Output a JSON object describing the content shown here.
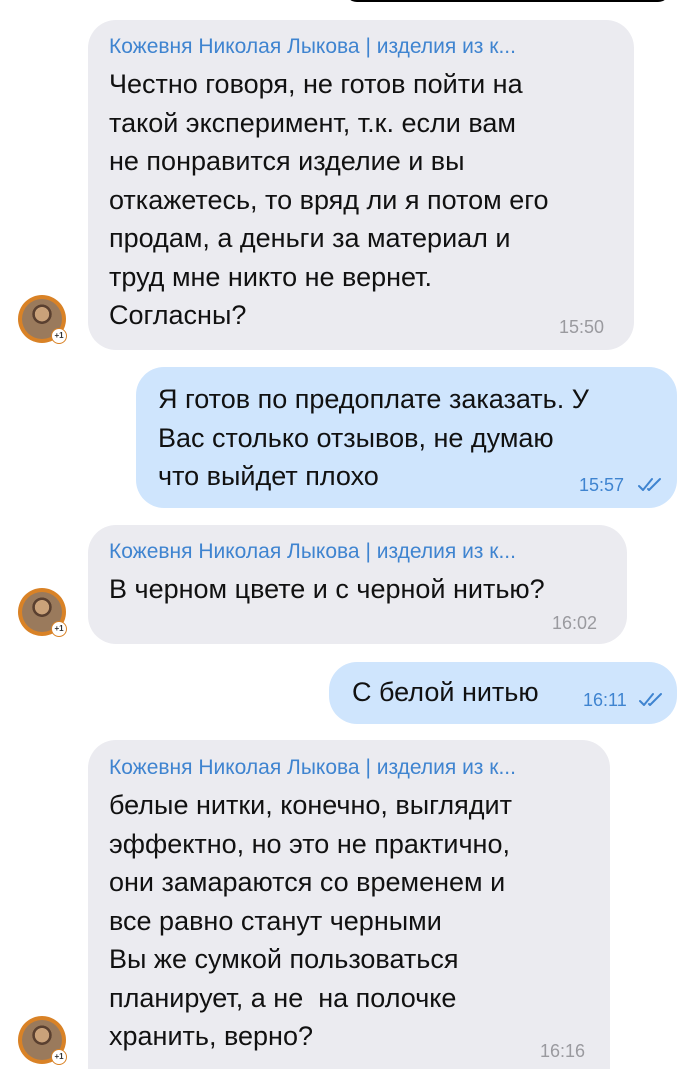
{
  "messages": [
    {
      "sender": "Кожевня Николая Лыкова | изделия из к...",
      "text": "Честно говоря, не готов пойти на\nтакой эксперимент, т.к. если вам\nне понравится изделие и вы\nоткажетесь, то вряд ли я потом его\nпродам, а деньги за материал и\nтруд мне никто не вернет.\nСогласны?",
      "time": "15:50"
    },
    {
      "text": "Я готов по предоплате заказать. У\nВас столько отзывов, не думаю\nчто выйдет плохо",
      "time": "15:57"
    },
    {
      "sender": "Кожевня Николая Лыкова | изделия из к...",
      "text": "В черном цвете и с черной нитью?",
      "time": "16:02"
    },
    {
      "text": "С белой нитью",
      "time": "16:11"
    },
    {
      "sender": "Кожевня Николая Лыкова | изделия из к...",
      "text": "белые нитки, конечно, выглядит\nэффектно, но это не практично,\nони замараются со временем и\nвсе равно станут черными\nВы же сумкой пользоваться\nпланирует, а не  на полочке\nхранить, верно?",
      "time": "16:16"
    }
  ],
  "avatar": {
    "badge": "+1",
    "icon": "shop-avatar-icon"
  },
  "colors": {
    "incoming": "#ebebf0",
    "outgoing": "#cfe5fd",
    "sender": "#3f84d0",
    "avatar_ring": "#d98226"
  }
}
